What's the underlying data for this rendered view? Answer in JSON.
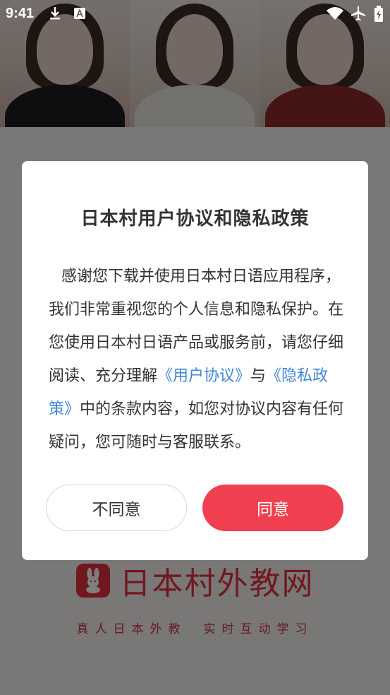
{
  "status_bar": {
    "time": "9:41",
    "left_icons": [
      "download-icon",
      "text-app-icon"
    ],
    "right_icons": [
      "wifi-icon",
      "airplane-mode-icon",
      "battery-icon"
    ]
  },
  "splash": {
    "brand_name": "日本村外教网",
    "slogan_left": "真人日本外教",
    "slogan_right": "实时互动学习",
    "brand_color": "#e2313f"
  },
  "dialog": {
    "title": "日本村用户协议和隐私政策",
    "body_part1": "感谢您下载并使用日本村日语应用程序，我们非常重视您的个人信息和隐私保护。在您使用日本村日语产品或服务前，请您仔细阅读、充分理解",
    "user_agreement_link": "《用户协议》",
    "body_part2": "与",
    "privacy_policy_link": "《隐私政策》",
    "body_part3": "中的条款内容，如您对协议内容有任何疑问，您可随时与客服联系。",
    "disagree_label": "不同意",
    "agree_label": "同意",
    "accent_color": "#f0404f",
    "link_color": "#3f86d6"
  }
}
